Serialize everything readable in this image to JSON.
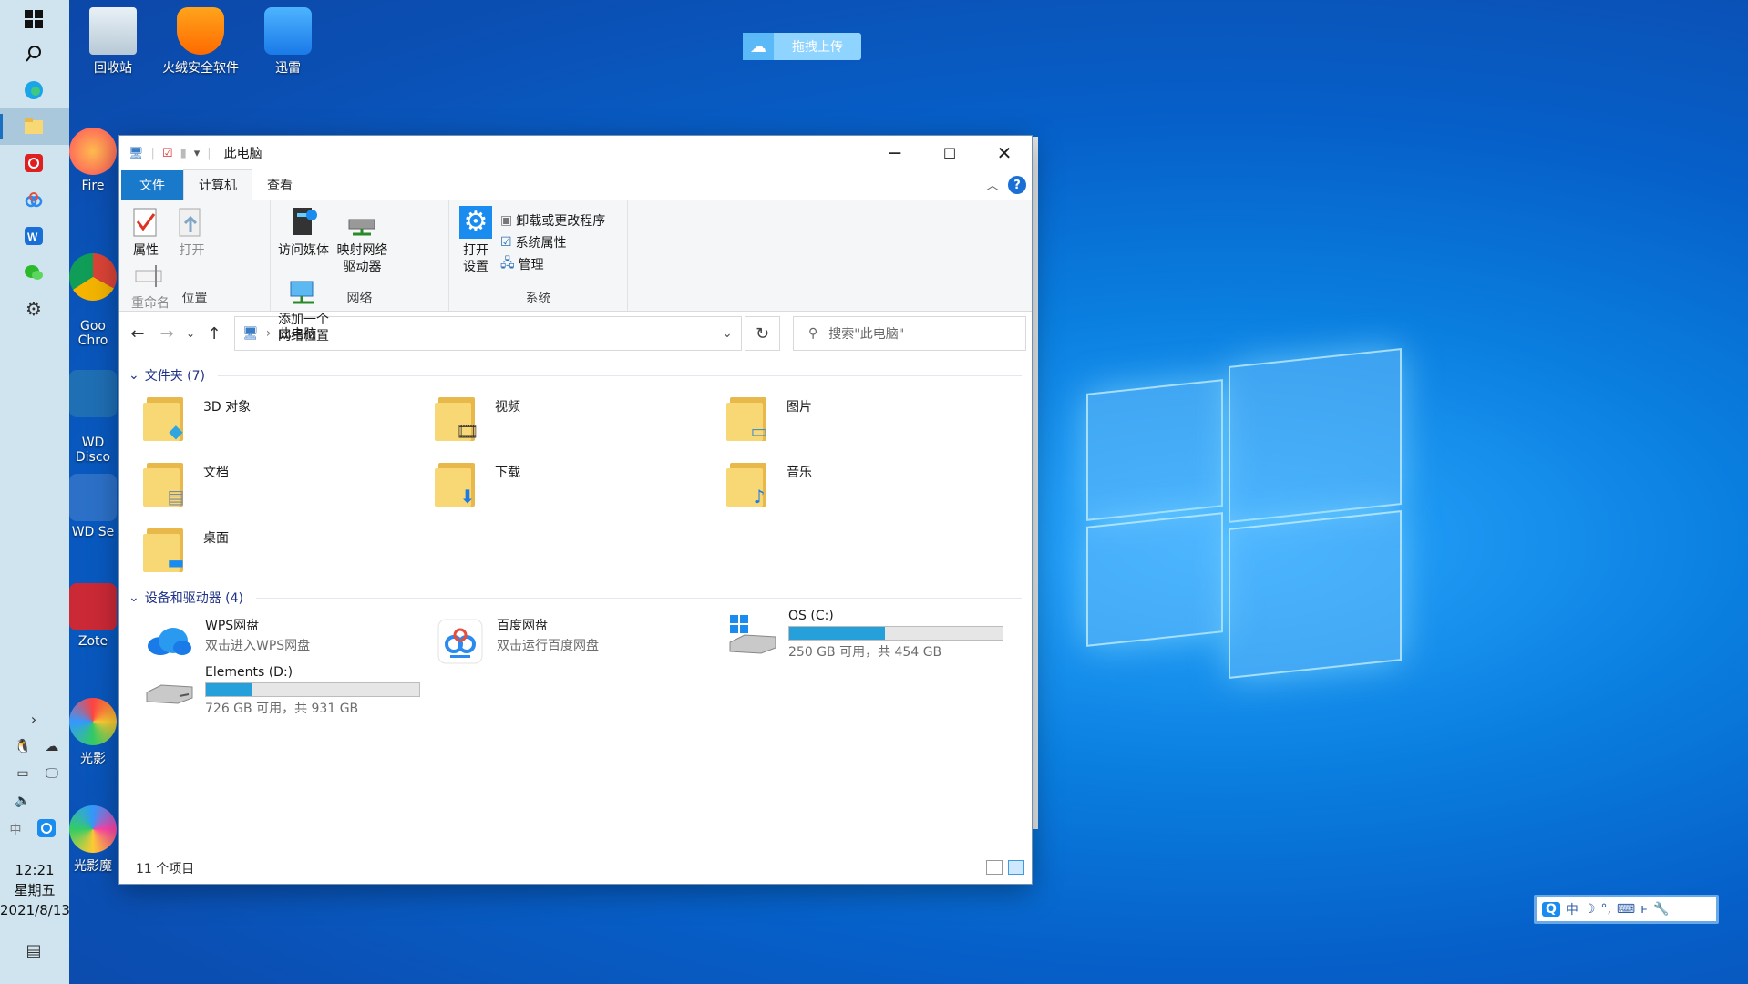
{
  "desktop": {
    "icons": [
      {
        "label": "回收站",
        "icon": "recycle-bin-icon"
      },
      {
        "label": "火绒安全软件",
        "icon": "huorong-icon"
      },
      {
        "label": "迅雷",
        "icon": "xunlei-icon"
      },
      {
        "label": "Fire",
        "icon": "firefox-icon"
      },
      {
        "label": "Goo\nChro",
        "icon": "chrome-icon"
      },
      {
        "label": "WD\nDisco",
        "icon": "wd-discovery-icon"
      },
      {
        "label": "WD Se",
        "icon": "wd-security-icon"
      },
      {
        "label": "Zote",
        "icon": "zotero-icon"
      },
      {
        "label": "光影",
        "icon": "guangying-icon"
      },
      {
        "label": "光影魔",
        "icon": "guangying-mo-icon"
      }
    ],
    "upload_widget": {
      "label": "拖拽上传"
    },
    "ime_bar": {
      "items": [
        "Q",
        "中",
        "☽",
        "°,",
        "⌨",
        "ⱶ",
        "🔧"
      ]
    }
  },
  "taskbar": {
    "clock_time": "12:21",
    "clock_day": "星期五",
    "clock_date": "2021/8/13"
  },
  "window": {
    "title": "此电脑",
    "tabs": [
      "文件",
      "计算机",
      "查看"
    ],
    "ribbon": {
      "groups": [
        {
          "label": "位置",
          "buttons": [
            {
              "label": "属性",
              "enabled": true
            },
            {
              "label": "打开",
              "enabled": false
            },
            {
              "label": "重命名",
              "enabled": false
            }
          ]
        },
        {
          "label": "网络",
          "buttons": [
            {
              "label": "访问媒体",
              "enabled": true
            },
            {
              "label": "映射网络\n驱动器",
              "enabled": true
            },
            {
              "label": "添加一个\n网络位置",
              "enabled": true
            }
          ]
        },
        {
          "label": "系统",
          "big": {
            "label": "打开\n设置"
          },
          "small": [
            {
              "label": "卸载或更改程序"
            },
            {
              "label": "系统属性"
            },
            {
              "label": "管理"
            }
          ]
        }
      ]
    },
    "address": {
      "path": "此电脑"
    },
    "search": {
      "placeholder": "搜索\"此电脑\""
    },
    "folders_header": "文件夹 (7)",
    "folders": [
      {
        "name": "3D 对象",
        "badge": "cube"
      },
      {
        "name": "视频",
        "badge": "film"
      },
      {
        "name": "图片",
        "badge": "picture"
      },
      {
        "name": "文档",
        "badge": "document"
      },
      {
        "name": "下载",
        "badge": "download-arrow"
      },
      {
        "name": "音乐",
        "badge": "music-note"
      },
      {
        "name": "桌面",
        "badge": "desktop"
      }
    ],
    "drives_header": "设备和驱动器 (4)",
    "drives": [
      {
        "name": "WPS网盘",
        "sub": "双击进入WPS网盘",
        "icon": "wps-cloud-icon"
      },
      {
        "name": "百度网盘",
        "sub": "双击运行百度网盘",
        "icon": "baidu-netdisk-icon"
      },
      {
        "name": "OS (C:)",
        "sub": "250 GB 可用，共 454 GB",
        "icon": "windows-drive-icon",
        "used_fraction": 0.449
      },
      {
        "name": "Elements (D:)",
        "sub": "726 GB 可用，共 931 GB",
        "icon": "hard-drive-icon",
        "used_fraction": 0.22
      }
    ],
    "status": "11 个项目"
  }
}
